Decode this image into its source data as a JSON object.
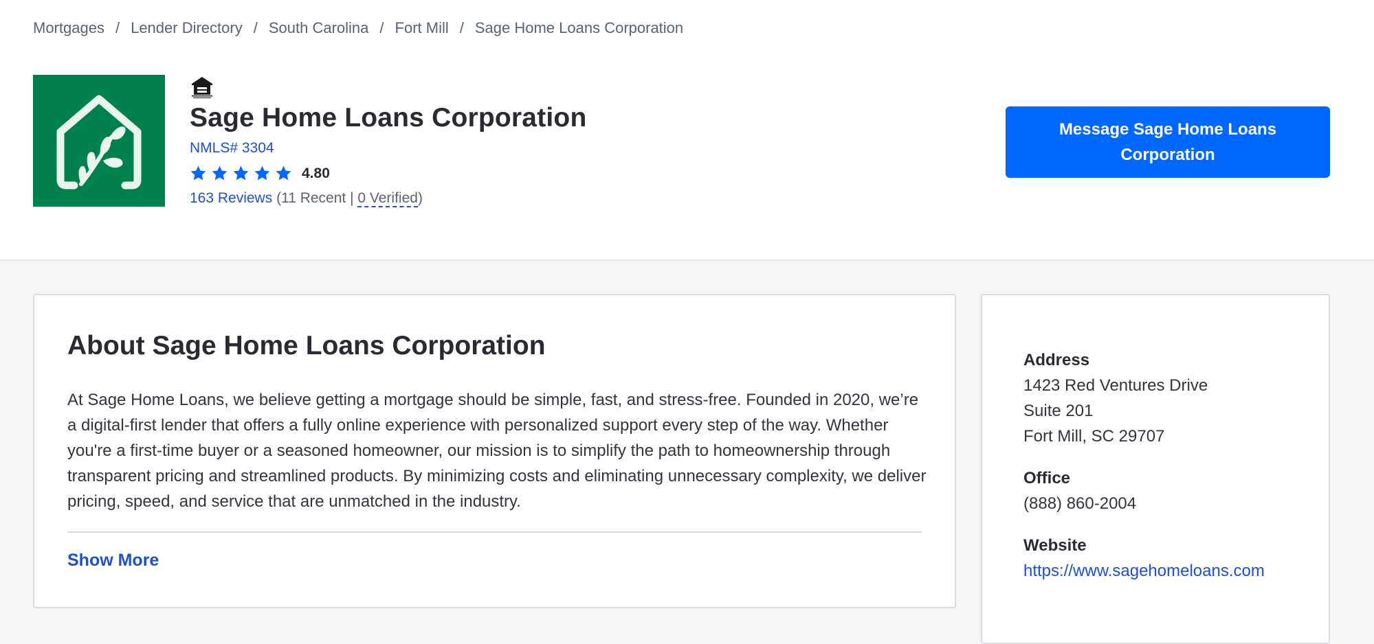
{
  "breadcrumb": [
    "Mortgages",
    "Lender Directory",
    "South Carolina",
    "Fort Mill",
    "Sage Home Loans Corporation"
  ],
  "lender": {
    "name": "Sage Home Loans Corporation",
    "nmls": "NMLS# 3304",
    "rating": "4.80",
    "stars": 5,
    "reviews_link": "163 Reviews",
    "recent_text": "(11 Recent | ",
    "verified_link": "0 Verified",
    "close_paren": ")"
  },
  "message_button": "Message Sage Home Loans Corporation",
  "about": {
    "title": "About Sage Home Loans Corporation",
    "text": "At Sage Home Loans, we believe getting a mortgage should be simple, fast, and stress-free. Founded in 2020, we’re a digital-first lender that offers a fully online experience with personalized support every step of the way. Whether you're a first-time buyer or a seasoned homeowner, our mission is to simplify the path to homeownership through transparent pricing and streamlined products. By minimizing costs and eliminating unnecessary complexity, we deliver pricing, speed, and service that are unmatched in the industry.",
    "show_more": "Show More"
  },
  "contact": {
    "address_label": "Address",
    "address_lines": [
      "1423 Red Ventures Drive",
      "Suite 201",
      "Fort Mill, SC 29707"
    ],
    "office_label": "Office",
    "office_phone": "(888) 860-2004",
    "website_label": "Website",
    "website_url": "https://www.sagehomeloans.com"
  },
  "colors": {
    "brand_green": "#00804a",
    "accent_blue": "#0068ff",
    "link_blue": "#1e51c8"
  }
}
